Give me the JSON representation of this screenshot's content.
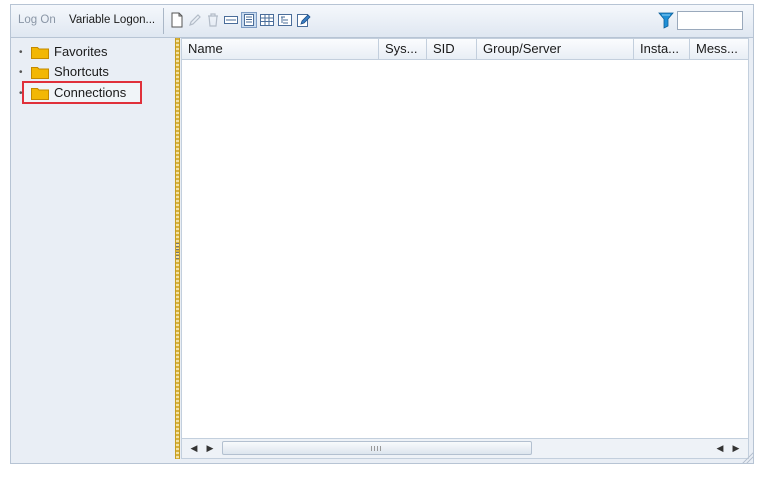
{
  "toolbar": {
    "logon_label": "Log On",
    "variable_logon_label": "Variable Logon...",
    "filter_value": ""
  },
  "tree": {
    "items": [
      {
        "label": "Favorites"
      },
      {
        "label": "Shortcuts"
      },
      {
        "label": "Connections"
      }
    ]
  },
  "grid": {
    "columns": [
      "Name",
      "Sys...",
      "SID",
      "Group/Server",
      "Insta...",
      "Mess..."
    ]
  },
  "colors": {
    "accent_highlight": "#e0303a",
    "folder": "#f2b705",
    "splitter": "#d7b13a",
    "filter_icon": "#1f8fd6"
  }
}
